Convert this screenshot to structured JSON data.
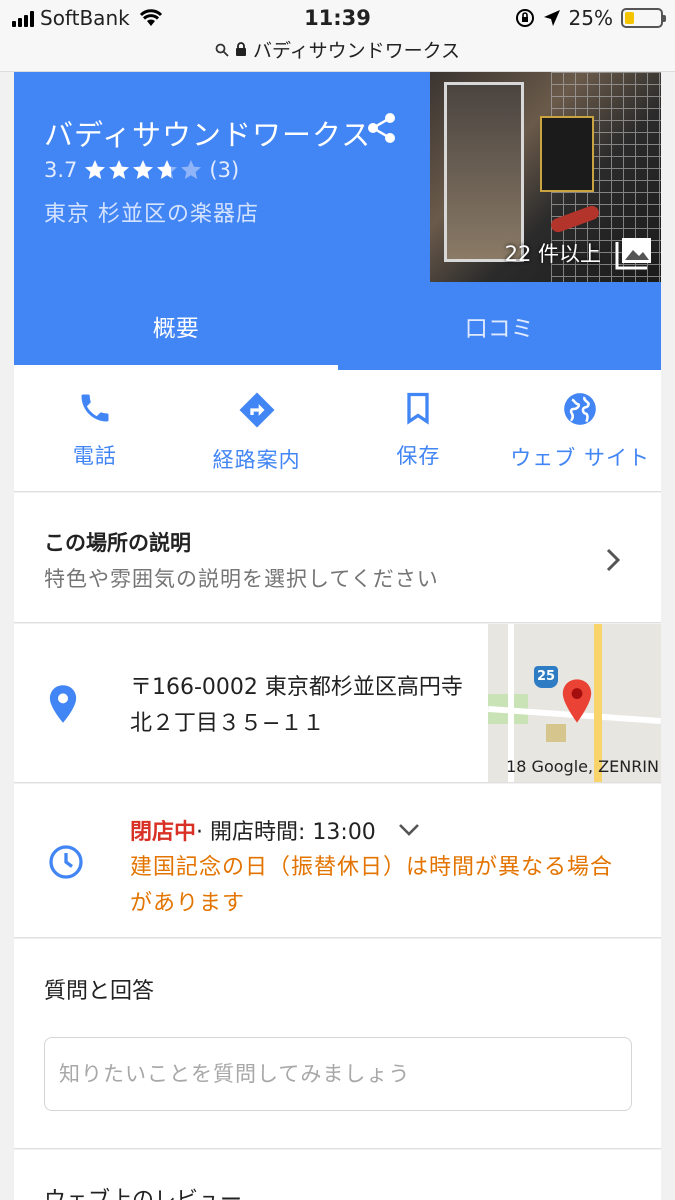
{
  "status_bar": {
    "carrier": "SoftBank",
    "time": "11:39",
    "battery_percent": "25%",
    "battery_level": 0.25,
    "url": "バディサウンドワークス"
  },
  "place": {
    "name": "バディサウンドワークス",
    "rating": "3.7",
    "rating_value": 3.7,
    "review_count": "(3)",
    "category": "東京 杉並区の楽器店",
    "photo_count": "22 件以上"
  },
  "tabs": [
    {
      "label": "概要",
      "active": true
    },
    {
      "label": "口コミ",
      "active": false
    }
  ],
  "actions": [
    {
      "label": "電話",
      "icon": "phone-icon"
    },
    {
      "label": "経路案内",
      "icon": "directions-icon"
    },
    {
      "label": "保存",
      "icon": "bookmark-icon"
    },
    {
      "label": "ウェブ サイト",
      "icon": "globe-icon"
    }
  ],
  "description": {
    "title": "この場所の説明",
    "subtitle": "特色や雰囲気の説明を選択してください"
  },
  "address": {
    "text": "〒166-0002 東京都杉並区高円寺北２丁目３５−１１",
    "map_credit": "18 Google, ZENRIN",
    "route_number": "25"
  },
  "hours": {
    "status": "閉店中",
    "open_time": " · 開店時間: 13:00",
    "notice": "建国記念の日（振替休日）は時間が異なる場合があります"
  },
  "qa": {
    "title": "質問と回答",
    "placeholder": "知りたいことを質問してみましょう"
  },
  "reviews": {
    "title": "ウェブ上のレビュー"
  },
  "colors": {
    "brand_blue": "#4285f4",
    "closed_red": "#d93025",
    "notice_orange": "#e37400",
    "pin_red": "#ea4335"
  }
}
